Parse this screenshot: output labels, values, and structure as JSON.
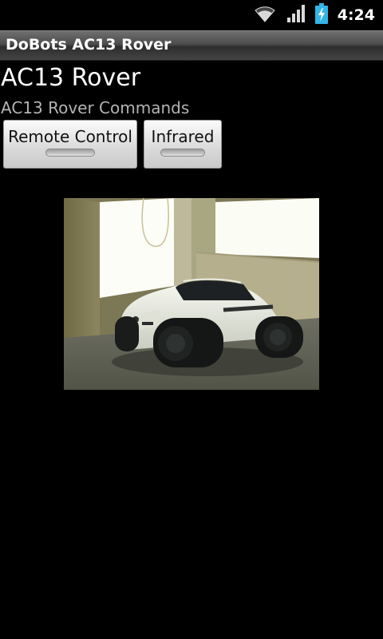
{
  "status_bar": {
    "time": "4:24",
    "icons": [
      "wifi-icon",
      "signal-icon",
      "battery-charging-icon"
    ]
  },
  "title_bar": {
    "title": "DoBots AC13 Rover"
  },
  "main": {
    "title": "AC13 Rover",
    "subtitle": "AC13 Rover Commands",
    "buttons": [
      {
        "label": "Remote Control"
      },
      {
        "label": "Infrared"
      }
    ],
    "camera": {
      "content": "video-feed-image"
    }
  },
  "colors": {
    "background": "#000000",
    "subtitle": "#b3b3b3",
    "battery": "#33b5e5"
  }
}
